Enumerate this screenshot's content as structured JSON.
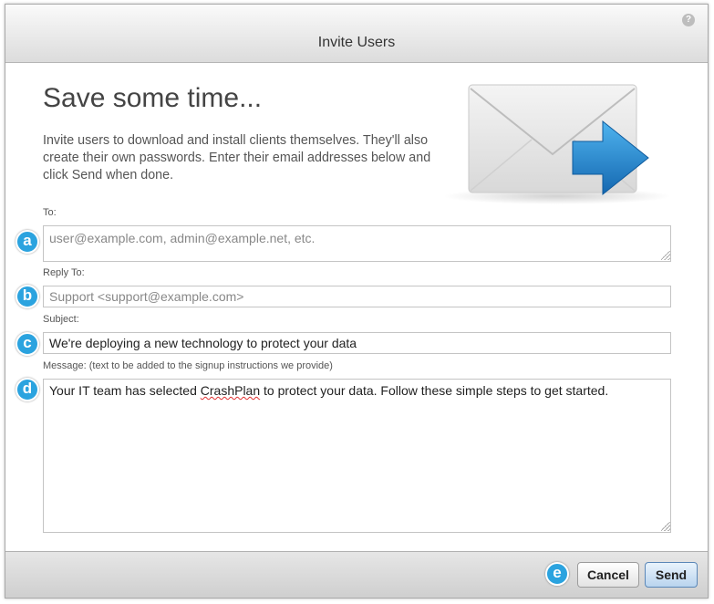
{
  "dialog": {
    "title": "Invite Users",
    "help_glyph": "?"
  },
  "intro": {
    "heading": "Save some time...",
    "text": "Invite users to download and install clients themselves. They'll also create their own passwords. Enter their email addresses below and click Send when done."
  },
  "form": {
    "to": {
      "label": "To:",
      "placeholder": "user@example.com, admin@example.net, etc.",
      "value": ""
    },
    "reply_to": {
      "label": "Reply To:",
      "placeholder": "Support <support@example.com>",
      "value": ""
    },
    "subject": {
      "label": "Subject:",
      "value": "We're deploying a new technology to protect your data"
    },
    "message": {
      "label": "Message: (text to be added to the signup instructions we provide)",
      "text_before": "Your IT team has selected ",
      "misspelled_word": "CrashPlan",
      "text_after": " to protect your data. Follow these simple steps to get started."
    }
  },
  "markers": {
    "a": "a",
    "b": "b",
    "c": "c",
    "d": "d",
    "e": "e"
  },
  "footer": {
    "cancel_label": "Cancel",
    "send_label": "Send"
  },
  "colors": {
    "marker": "#2ba3df",
    "arrow": "#1c7fc4",
    "send_button": "#b9d4ee"
  },
  "icons": {
    "help": "question-mark-icon",
    "envelope": "envelope-arrow-icon"
  }
}
